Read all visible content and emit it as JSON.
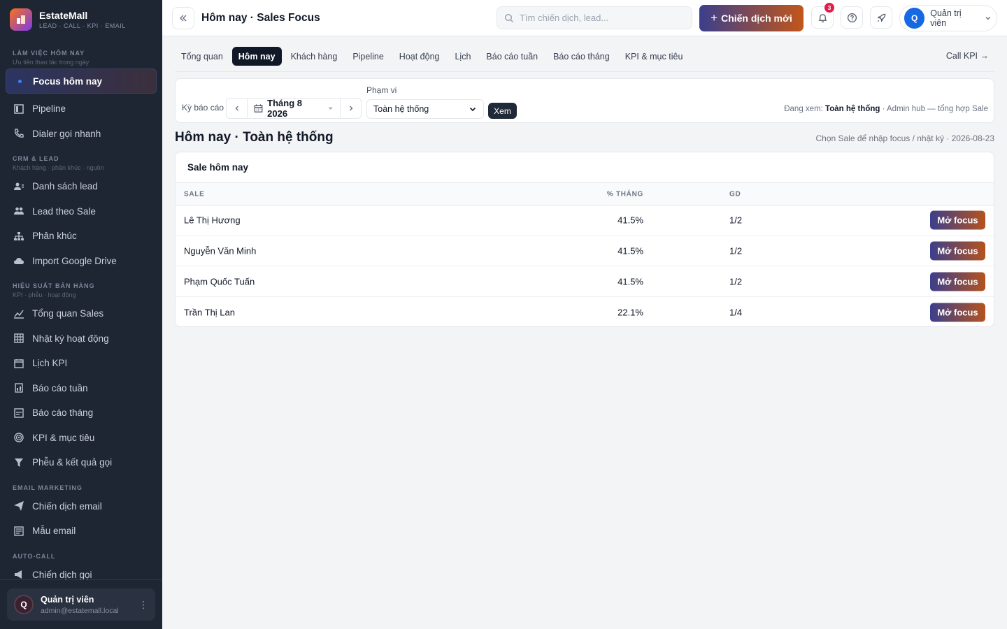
{
  "brand": {
    "name": "EstateMall",
    "subtitle": "LEAD · CALL · KPI · EMAIL"
  },
  "sidebar": {
    "sections": [
      {
        "title": "LÀM VIỆC HÔM NAY",
        "subtitle": "Ưu tiên thao tác trong ngày"
      },
      {
        "title": "CRM & LEAD",
        "subtitle": "Khách hàng · phân khúc · nguồn"
      },
      {
        "title": "HIỆU SUẤT BÁN HÀNG",
        "subtitle": "KPI · phễu · hoạt động"
      },
      {
        "title": "EMAIL MARKETING",
        "subtitle": ""
      },
      {
        "title": "AUTO-CALL",
        "subtitle": ""
      }
    ],
    "items": {
      "focus": "Focus hôm nay",
      "pipeline": "Pipeline",
      "dialer": "Dialer gọi nhanh",
      "lead_list": "Danh sách lead",
      "lead_by_sale": "Lead theo Sale",
      "segments": "Phân khúc",
      "import_drive": "Import Google Drive",
      "sales_overview": "Tổng quan Sales",
      "activity_log": "Nhật ký hoạt động",
      "kpi_calendar": "Lịch KPI",
      "weekly_report": "Báo cáo tuần",
      "monthly_report": "Báo cáo tháng",
      "kpi_goals": "KPI & mục tiêu",
      "funnel": "Phễu & kết quả gọi",
      "email_campaign": "Chiến dịch email",
      "email_template": "Mẫu email",
      "call_campaign": "Chiến dịch gọi"
    },
    "user": {
      "initial": "Q",
      "name": "Quản trị viên",
      "email": "admin@estatemall.local"
    }
  },
  "topbar": {
    "title": "Hôm nay · Sales Focus",
    "search_placeholder": "Tìm chiến dịch, lead...",
    "new_campaign": "Chiến dịch mới",
    "notifications": "3",
    "account_initial": "Q",
    "account_name": "Quản trị viên"
  },
  "tabs": [
    "Tổng quan",
    "Hôm nay",
    "Khách hàng",
    "Pipeline",
    "Hoạt động",
    "Lịch",
    "Báo cáo tuần",
    "Báo cáo tháng",
    "KPI & mục tiêu"
  ],
  "call_kpi": "Call KPI →",
  "filter": {
    "period_label": "Kỳ báo cáo",
    "period_value": "Tháng 8 2026",
    "scope_label": "Phạm vi",
    "scope_value": "Toàn hệ thống",
    "view_button": "Xem",
    "viewing_prefix": "Đang xem:",
    "viewing_scope": "Toàn hệ thống",
    "viewing_suffix": "· Admin hub — tổng hợp Sale"
  },
  "section": {
    "title": "Hôm nay · Toàn hệ thống",
    "hint": "Chọn Sale để nhập focus / nhật ký · 2026-08-23"
  },
  "table": {
    "title": "Sale hôm nay",
    "columns": {
      "sale": "SALE",
      "pct": "% THÁNG",
      "gd": "GD"
    },
    "action_label": "Mở focus",
    "rows": [
      {
        "sale": "Lê Thị Hương",
        "pct": "41.5%",
        "gd": "1/2"
      },
      {
        "sale": "Nguyễn Văn Minh",
        "pct": "41.5%",
        "gd": "1/2"
      },
      {
        "sale": "Phạm Quốc Tuấn",
        "pct": "41.5%",
        "gd": "1/2"
      },
      {
        "sale": "Trần Thị Lan",
        "pct": "22.1%",
        "gd": "1/4"
      }
    ]
  },
  "colors": {
    "sidebar_bg": "#1e2533",
    "accent_start": "#3b3f8c",
    "accent_end": "#c2561a",
    "badge": "#e11d48",
    "avatar": "#1668e3"
  }
}
